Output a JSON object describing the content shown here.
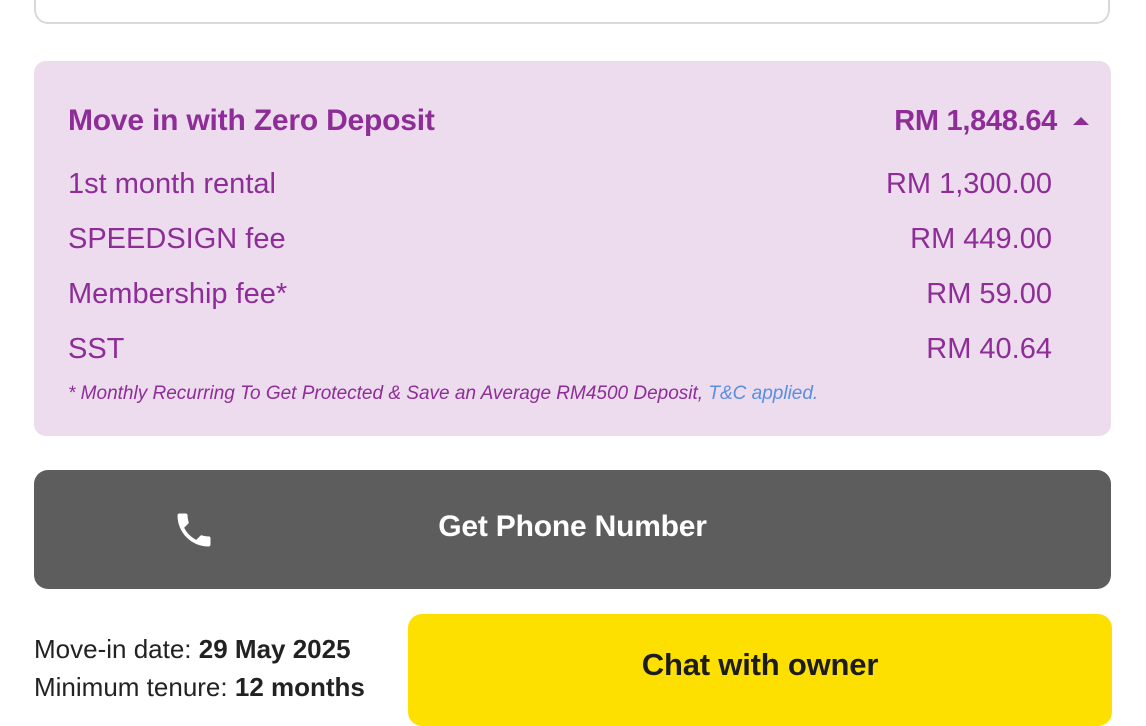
{
  "deposit": {
    "title": "Move in with Zero Deposit",
    "total": "RM 1,848.64",
    "items": [
      {
        "label": "1st month rental",
        "amount": "RM 1,300.00"
      },
      {
        "label": "SPEEDSIGN fee",
        "amount": "RM 449.00"
      },
      {
        "label": "Membership fee*",
        "amount": "RM 59.00"
      },
      {
        "label": "SST",
        "amount": "RM 40.64"
      }
    ],
    "footnote": "* Monthly Recurring To Get Protected & Save an Average RM4500 Deposit,",
    "tnc_link": "T&C applied."
  },
  "phone": {
    "label": "Get Phone Number",
    "icon": "phone-icon"
  },
  "move_info": {
    "date_label": "Move-in date:",
    "date_value": "29 May 2025",
    "tenure_label": "Minimum tenure:",
    "tenure_value": "12 months"
  },
  "chat": {
    "label": "Chat with owner"
  },
  "colors": {
    "accent_purple": "#8e2d97",
    "panel_bg": "#ecdcee",
    "phone_button_bg": "#5d5d5d",
    "chat_button_bg": "#fde000",
    "link_blue": "#5b8ee0"
  }
}
